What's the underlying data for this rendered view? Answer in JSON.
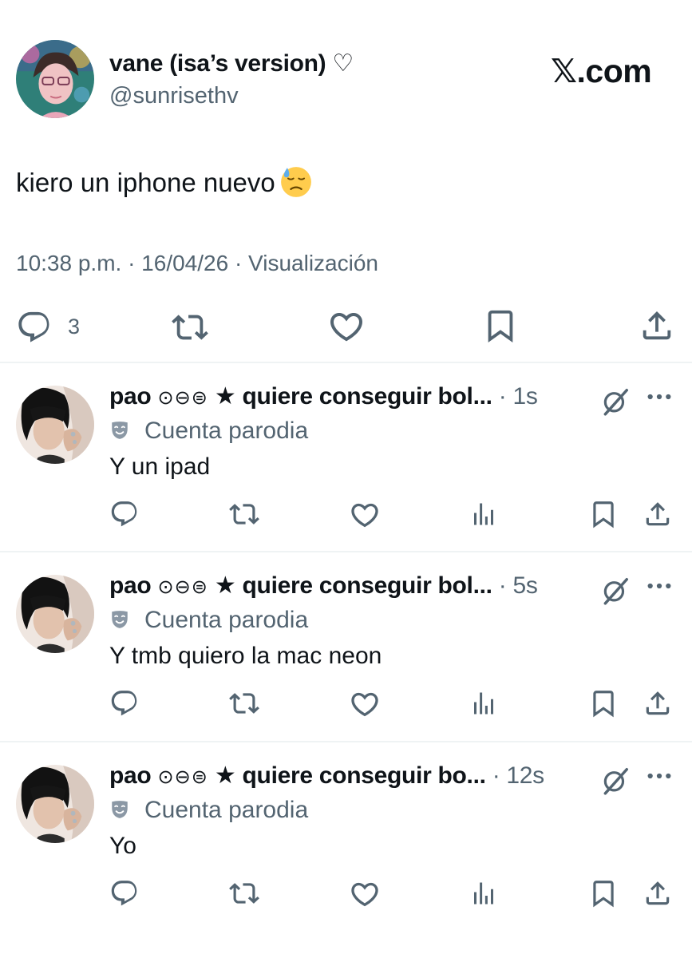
{
  "main_tweet": {
    "author_name": "vane (isa’s version)",
    "author_heart": "♡",
    "handle": "@sunrisethv",
    "site_label": "𝕏.com",
    "text": "kiero un iphone nuevo",
    "emoji": "downcast-face-with-sweat",
    "meta": "10:38 p.m. · 16/04/26 · Visualización",
    "reply_count": "3",
    "icons": [
      "reply-icon",
      "retweet-icon",
      "like-icon",
      "bookmark-icon",
      "share-icon"
    ]
  },
  "replies": [
    {
      "name": "pao",
      "badges": "⊙⊖⊜",
      "star": "★",
      "name_rest": "quiere conseguir bol...",
      "time": "· 1s",
      "parody_label": "Cuenta parodia",
      "text": "Y un ipad"
    },
    {
      "name": "pao",
      "badges": "⊙⊖⊜",
      "star": "★",
      "name_rest": "quiere conseguir bol...",
      "time": "· 5s",
      "parody_label": "Cuenta parodia",
      "text": "Y tmb quiero la mac neon"
    },
    {
      "name": "pao",
      "badges": "⊙⊖⊜",
      "star": "★",
      "name_rest": "quiere conseguir bo...",
      "time": "· 12s",
      "parody_label": "Cuenta parodia",
      "text": "Yo"
    }
  ],
  "colors": {
    "text": "#0f1419",
    "secondary": "#536471",
    "divider": "#eff3f4",
    "emoji": "#ffcc4d"
  }
}
